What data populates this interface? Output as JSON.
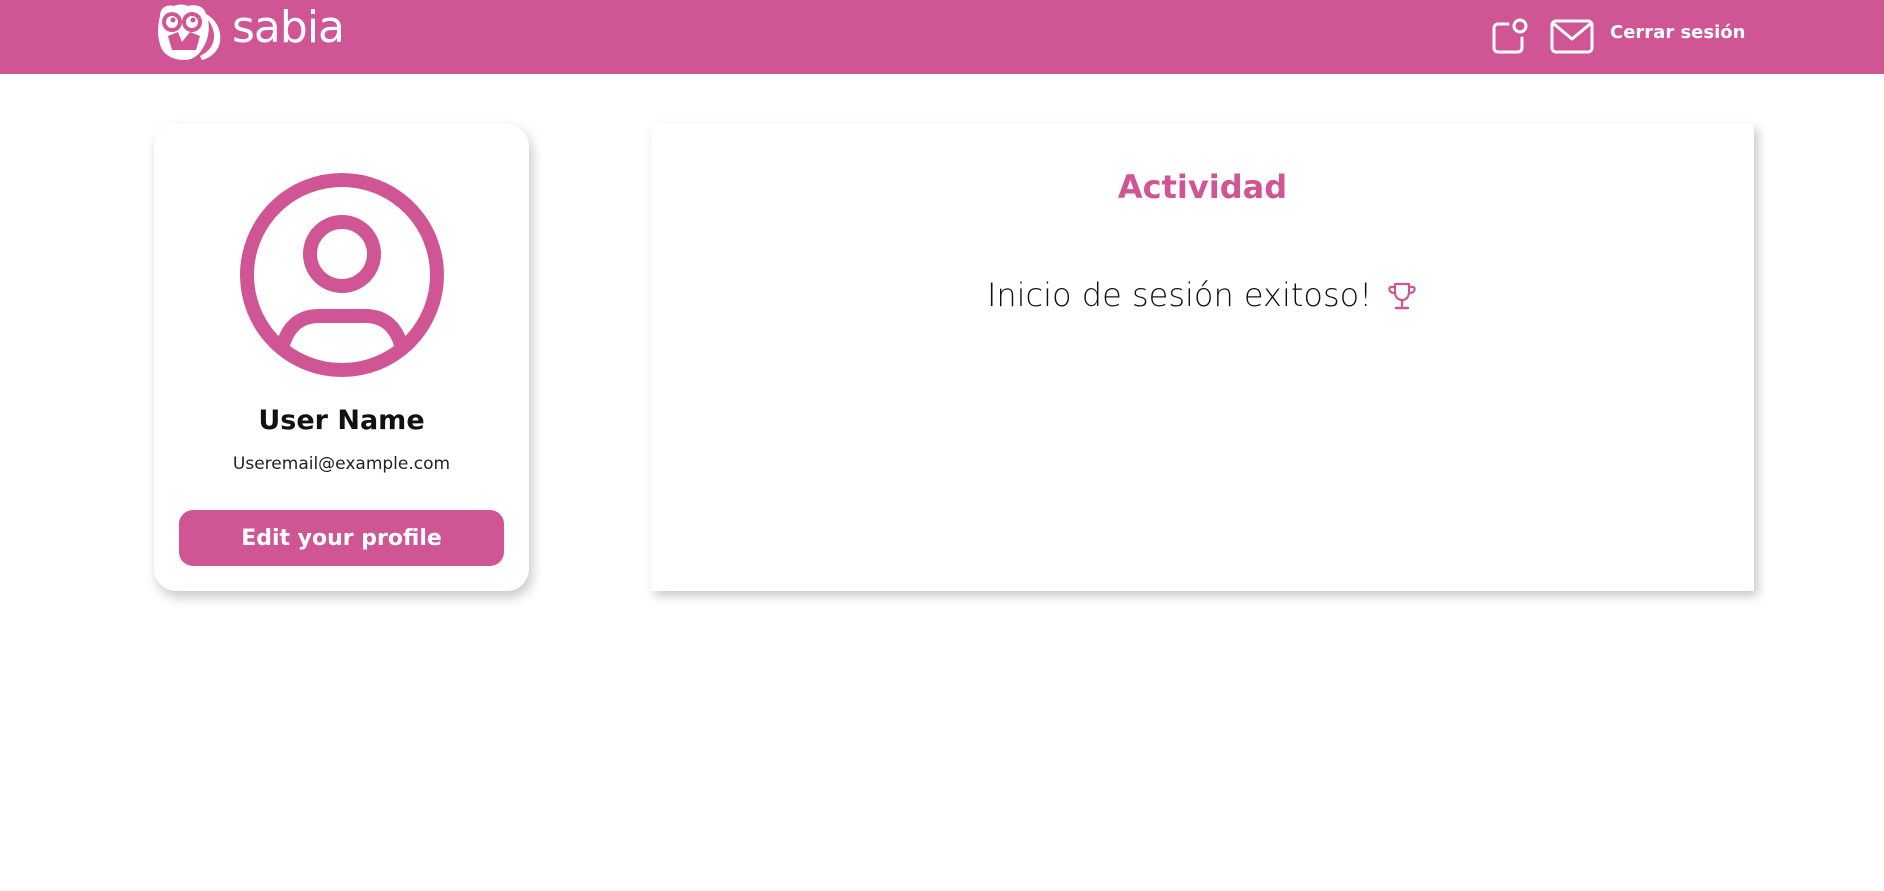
{
  "header": {
    "brand": "sabia",
    "logout_label": "Cerrar sesión",
    "background_color": "#d05594",
    "icons": [
      "notification-icon",
      "mail-icon"
    ]
  },
  "profile": {
    "avatar_icon": "user-circle-icon",
    "name": "User Name",
    "email": "Useremail@example.com",
    "edit_label": "Edit your profile"
  },
  "activity": {
    "title": "Actividad",
    "message": "Inicio de sesión exitoso!",
    "message_icon": "trophy-icon"
  },
  "colors": {
    "accent": "#d05594",
    "text": "#111111",
    "background": "#ffffff"
  }
}
